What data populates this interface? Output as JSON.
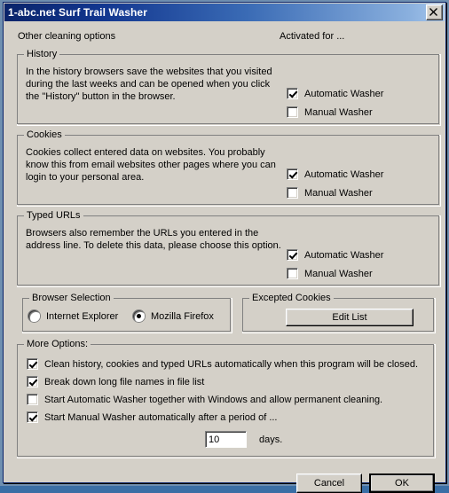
{
  "window": {
    "title": "1-abc.net Surf Trail Washer",
    "close_icon": "close-icon",
    "accent_color": "#0a246a",
    "face_color": "#d4d0c8"
  },
  "header": {
    "left_label": "Other cleaning options",
    "right_label": "Activated for ..."
  },
  "sections": [
    {
      "legend": "History",
      "description": "In the history browsers save the websites that you visited during the last weeks and can be opened when you click the \"History\" button in the browser.",
      "options": [
        {
          "label": "Automatic Washer",
          "checked": true
        },
        {
          "label": "Manual Washer",
          "checked": false
        }
      ]
    },
    {
      "legend": "Cookies",
      "description": "Cookies collect entered data on websites. You probably know this from email websites other pages where you can login to your personal area.",
      "options": [
        {
          "label": "Automatic Washer",
          "checked": true
        },
        {
          "label": "Manual Washer",
          "checked": false
        }
      ]
    },
    {
      "legend": "Typed URLs",
      "description": "Browsers also remember the URLs you entered in the address line. To delete this data, please choose this option.",
      "options": [
        {
          "label": "Automatic Washer",
          "checked": true
        },
        {
          "label": "Manual Washer",
          "checked": false
        }
      ]
    }
  ],
  "browser_selection": {
    "legend": "Browser Selection",
    "options": [
      {
        "label": "Internet Explorer",
        "selected": false
      },
      {
        "label": "Mozilla Firefox",
        "selected": true
      }
    ]
  },
  "excepted_cookies": {
    "legend": "Excepted Cookies",
    "edit_list_label": "Edit List"
  },
  "more_options": {
    "legend": "More Options:",
    "items": [
      {
        "label": "Clean history, cookies and typed URLs automatically when this program will be closed.",
        "checked": true
      },
      {
        "label": "Break down long file names in file list",
        "checked": true
      },
      {
        "label": "Start Automatic Washer together with Windows and allow permanent cleaning.",
        "checked": false
      },
      {
        "label": "Start Manual Washer automatically after a period of ...",
        "checked": true
      }
    ],
    "period_value": "10",
    "period_unit": "days."
  },
  "footer": {
    "cancel_label": "Cancel",
    "ok_label": "OK"
  }
}
